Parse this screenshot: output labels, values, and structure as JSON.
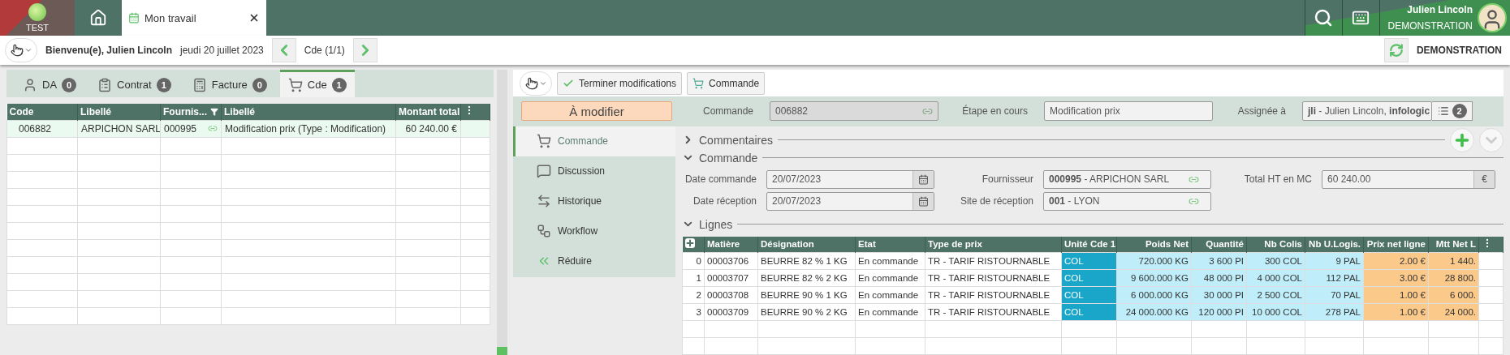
{
  "app_bar": {
    "env_label": "TEST",
    "tabs": [
      {
        "label": "Mon travail",
        "selected": true
      }
    ],
    "user": {
      "name": "Julien Lincoln",
      "company": "DEMONSTRATION"
    }
  },
  "toolbar": {
    "welcome": "Bienvenu(e), Julien Lincoln",
    "date": "jeudi 20 juillet 2023",
    "pager": "Cde (1/1)",
    "site": "DEMONSTRATION"
  },
  "work_tabs": [
    {
      "label": "DA",
      "count": "0",
      "selected": false
    },
    {
      "label": "Contrat",
      "count": "1",
      "selected": false
    },
    {
      "label": "Facture",
      "count": "0",
      "selected": false
    },
    {
      "label": "Cde",
      "count": "1",
      "selected": true
    }
  ],
  "work_table": {
    "columns": [
      {
        "label": "Code",
        "filter": false
      },
      {
        "label": "Libellé",
        "filter": false
      },
      {
        "label": "Fournis...",
        "filter": true
      },
      {
        "label": "Libellé",
        "filter": false
      },
      {
        "label": "Montant total",
        "filter": false
      }
    ],
    "rows": [
      {
        "selected": true,
        "cells": [
          "006882",
          "ARPICHON SARL",
          "000995",
          "Modification prix (Type : Modification)",
          "60 240.00 €"
        ]
      }
    ]
  },
  "actions": [
    "Terminer modifications",
    "Commande"
  ],
  "status": "À modifier",
  "header_fields": [
    {
      "label": "Commande",
      "value": "006882",
      "disabled": true
    },
    {
      "label": "Étape en cours",
      "value": "Modification prix",
      "disabled": false
    },
    {
      "label": "Assignée à",
      "value": "**jli** - Julien Lincoln, **infologic**",
      "disabled": false,
      "count": "2"
    }
  ],
  "nav": [
    {
      "label": "Commande",
      "selected": true
    },
    {
      "label": "Discussion",
      "selected": false
    },
    {
      "label": "Historique",
      "selected": false
    },
    {
      "label": "Workflow",
      "selected": false
    },
    {
      "label": "Réduire",
      "selected": false
    }
  ],
  "sections": [
    {
      "title": "Commentaires",
      "expanded": false
    },
    {
      "title": "Commande",
      "expanded": true
    },
    {
      "title": "Lignes",
      "expanded": true
    }
  ],
  "form": [
    {
      "label": "Date commande",
      "value": "20/07/2023",
      "kind": "date"
    },
    {
      "label": "Fournisseur",
      "value": "**000995** - ARPICHON SARL",
      "kind": "link"
    },
    {
      "label": "Total HT en MC",
      "value": "60 240.00",
      "kind": "amount",
      "unit": "€"
    },
    {
      "label": "Date réception",
      "value": "20/07/2023",
      "kind": "date"
    },
    {
      "label": "Site de réception",
      "value": "**001** - LYON",
      "kind": "link"
    }
  ],
  "lines_table": {
    "columns": [
      {
        "label": "Matière",
        "kind": "text"
      },
      {
        "label": "Désignation",
        "kind": "text"
      },
      {
        "label": "Etat",
        "kind": "text"
      },
      {
        "label": "Type de prix",
        "kind": "text"
      },
      {
        "label": "Unité Cde 1",
        "kind": "unit"
      },
      {
        "label": "Poids Net",
        "kind": "measure"
      },
      {
        "label": "Quantité",
        "kind": "measure"
      },
      {
        "label": "Nb Colis",
        "kind": "measure"
      },
      {
        "label": "Nb U.Logis.",
        "kind": "measure"
      },
      {
        "label": "Prix net ligne",
        "kind": "price"
      },
      {
        "label": "Mtt Net L",
        "kind": "price"
      }
    ],
    "rows": [
      {
        "index": "0",
        "cells": [
          "00003706",
          "BEURRE 82 % 1 KG",
          "En commande",
          "TR - TARIF RISTOURNABLE",
          "COL",
          "720.000 KG",
          "3 600 PI",
          "300 COL",
          "9 PAL",
          "2.00 €",
          "1 440."
        ]
      },
      {
        "index": "1",
        "cells": [
          "00003707",
          "BEURRE 82 % 2 KG",
          "En commande",
          "TR - TARIF RISTOURNABLE",
          "COL",
          "9 600.000 KG",
          "48 000 PI",
          "4 000 COL",
          "112 PAL",
          "3.00 €",
          "28 800."
        ]
      },
      {
        "index": "2",
        "cells": [
          "00003708",
          "BEURRE 90 % 1 KG",
          "En commande",
          "TR - TARIF RISTOURNABLE",
          "COL",
          "6 000.000 KG",
          "30 000 PI",
          "2 500 COL",
          "70 PAL",
          "1.00 €",
          "6 000."
        ]
      },
      {
        "index": "3",
        "cells": [
          "00003709",
          "BEURRE 90 % 2 KG",
          "En commande",
          "TR - TARIF RISTOURNABLE",
          "COL",
          "24 000.000 KG",
          "120 000 PI",
          "10 000 COL",
          "278 PAL",
          "1.00 €",
          "24 000."
        ]
      }
    ]
  }
}
